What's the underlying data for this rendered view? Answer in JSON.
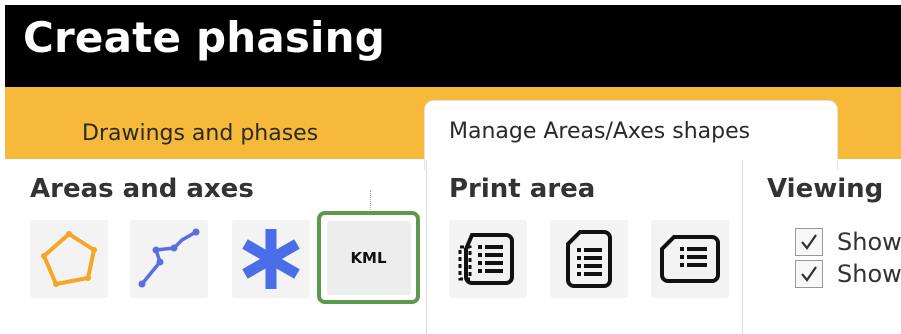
{
  "window": {
    "title": "Create phasing"
  },
  "tabs": [
    {
      "label": "Drawings and phases",
      "active": false
    },
    {
      "label": "Manage Areas/Axes shapes",
      "active": true
    }
  ],
  "groups": {
    "areas_axes": {
      "title": "Areas and axes",
      "buttons": [
        {
          "icon": "polygon-icon",
          "color": "#f5a623"
        },
        {
          "icon": "polyline-icon",
          "color": "#5b6ee1"
        },
        {
          "icon": "asterisk-icon",
          "color": "#4a6ee8"
        },
        {
          "icon": "kml-icon",
          "label": "KML",
          "highlight_color": "#5a9a4a"
        }
      ]
    },
    "print_area": {
      "title": "Print area",
      "buttons": [
        {
          "icon": "print-area-landscape-icon"
        },
        {
          "icon": "print-area-portrait-icon"
        },
        {
          "icon": "print-area-wide-icon"
        }
      ]
    },
    "viewing": {
      "title": "Viewing",
      "checkboxes": [
        {
          "label": "Show",
          "checked": true
        },
        {
          "label": "Show",
          "checked": true
        }
      ]
    }
  },
  "colors": {
    "titlebar": "#000000",
    "tabstrip": "#f7b93a",
    "accent_green": "#5a9a4a"
  }
}
